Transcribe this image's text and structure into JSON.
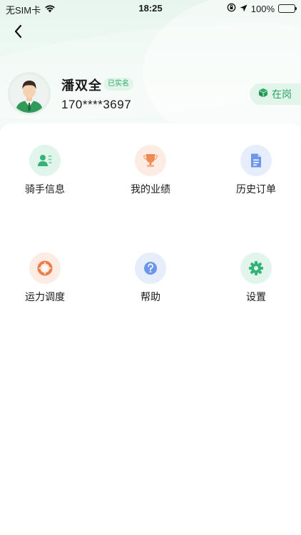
{
  "status_bar": {
    "carrier": "无SIM卡",
    "time": "18:25",
    "battery": "100%"
  },
  "profile": {
    "name": "潘双全",
    "verified_badge": "已实名",
    "phone": "170****3697",
    "duty_status": "在岗"
  },
  "menu": {
    "rider_info": "骑手信息",
    "performance": "我的业绩",
    "history_orders": "历史订单",
    "dispatch": "运力调度",
    "help": "帮助",
    "settings": "设置"
  },
  "colors": {
    "accent_green": "#28a462",
    "rider_info_bg": "#e2f5ec",
    "performance_bg": "#fdece3",
    "history_bg": "#e6eefb",
    "dispatch_bg": "#fdece3",
    "help_bg": "#e6eefb",
    "settings_bg": "#e2f5ec"
  }
}
